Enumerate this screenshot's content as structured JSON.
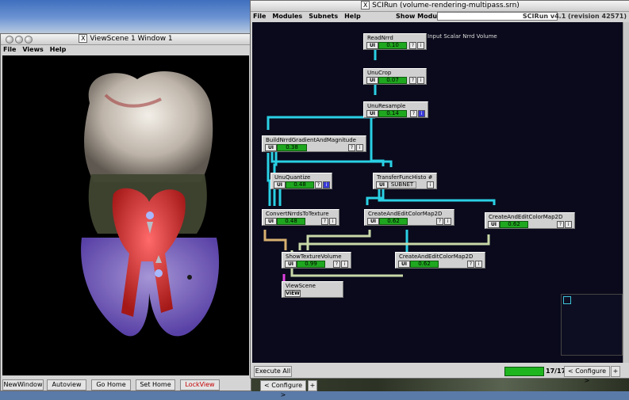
{
  "viewscene": {
    "title": "ViewScene 1 Window 1",
    "menu": [
      "File",
      "Views",
      "Help"
    ],
    "buttons": {
      "new_window": "NewWindow",
      "autoview": "Autoview",
      "go_home": "Go Home",
      "set_home": "Set Home",
      "lock_view": "LockView"
    }
  },
  "scirun": {
    "title": "SCIRun (volume-rendering-multipass.srn)",
    "menu": [
      "File",
      "Modules",
      "Subnets",
      "Help"
    ],
    "show_module_label": "Show Module:",
    "version": "SCIRun v4.1 (revision 42571)",
    "execute_all": "Execute All",
    "module_count": "17/17",
    "configure": "< Configure >",
    "configure_arrow": "+",
    "network_note": "Input Scalar Nrrd Volume",
    "modules": [
      {
        "name": "ReadNrrd",
        "ui": "UI",
        "progress": "0.10",
        "extra": [
          "?",
          "i"
        ]
      },
      {
        "name": "UnuCrop",
        "ui": "UI",
        "progress": "0.07",
        "extra": [
          "?",
          "i"
        ]
      },
      {
        "name": "UnuResample",
        "ui": "UI",
        "progress": "0.14",
        "extra": [
          "?",
          "i"
        ]
      },
      {
        "name": "BuildNrrdGradientAndMagnitude",
        "ui": "UI",
        "progress": "0.38",
        "extra": [
          "?",
          "i"
        ]
      },
      {
        "name": "UnuQuantize",
        "ui": "UI",
        "progress": "0.48",
        "extra": [
          "?",
          "i"
        ]
      },
      {
        "name": "TransferFuncHisto #",
        "ui": "UI",
        "progress": "SUBNET",
        "extra": [
          "i"
        ]
      },
      {
        "name": "ConvertNrrdsToTexture",
        "ui": "UI",
        "progress": "0.48",
        "extra": [
          "?",
          "i"
        ]
      },
      {
        "name": "CreateAndEditColorMap2D",
        "ui": "UI",
        "progress": "0.62",
        "extra": [
          "?",
          "i"
        ]
      },
      {
        "name": "CreateAndEditColorMap2D",
        "ui": "UI",
        "progress": "0.62",
        "extra": [
          "?",
          "i"
        ]
      },
      {
        "name": "ShowTextureVolume",
        "ui": "UI",
        "progress": "0.99",
        "extra": [
          "?",
          "i"
        ]
      },
      {
        "name": "CreateAndEditColorMap2D",
        "ui": "UI",
        "progress": "0.62",
        "extra": [
          "?",
          "i"
        ]
      },
      {
        "name": "ViewScene",
        "ui": "VIEW",
        "progress": "",
        "extra": []
      }
    ]
  },
  "desktop_bottom": {
    "configure": "< Configure >",
    "configure_arrow": "+"
  }
}
